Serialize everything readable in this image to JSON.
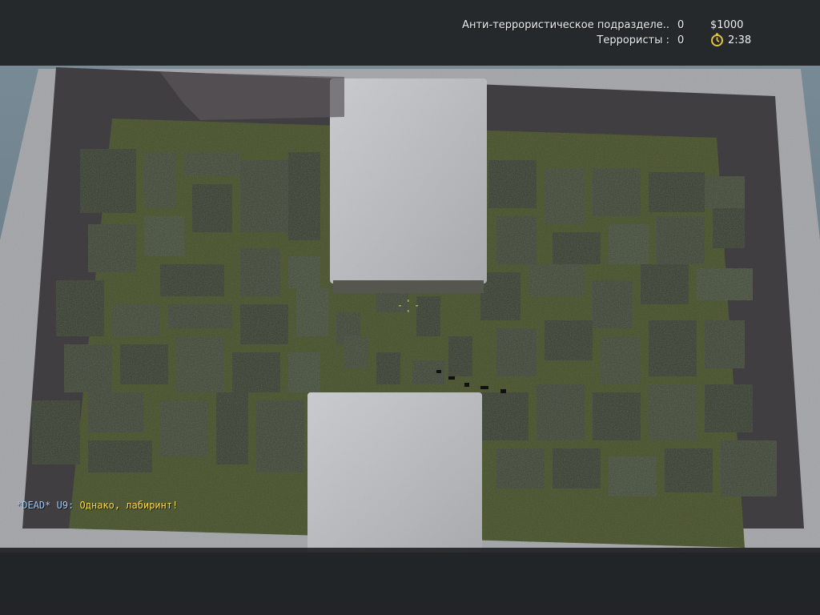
{
  "hud": {
    "scoreboard": {
      "ct_team_name": "Анти-террористическое подразделе..",
      "ct_score": "0",
      "t_team_name": "Террористы :",
      "t_score": "0"
    },
    "money": "$1000",
    "timer": "2:38",
    "timer_icon": "stopwatch-icon"
  },
  "chat": {
    "tag": "*DEAD*",
    "player": "U9:",
    "message": "Однако, лабиринт!"
  },
  "colors": {
    "hud_text": "#eeeeee",
    "chat_tag": "#9fc8f2",
    "chat_message": "#ffd54a",
    "hedge": "#3b4333",
    "floor": "#46502a",
    "concrete": "#b7b9bd"
  }
}
